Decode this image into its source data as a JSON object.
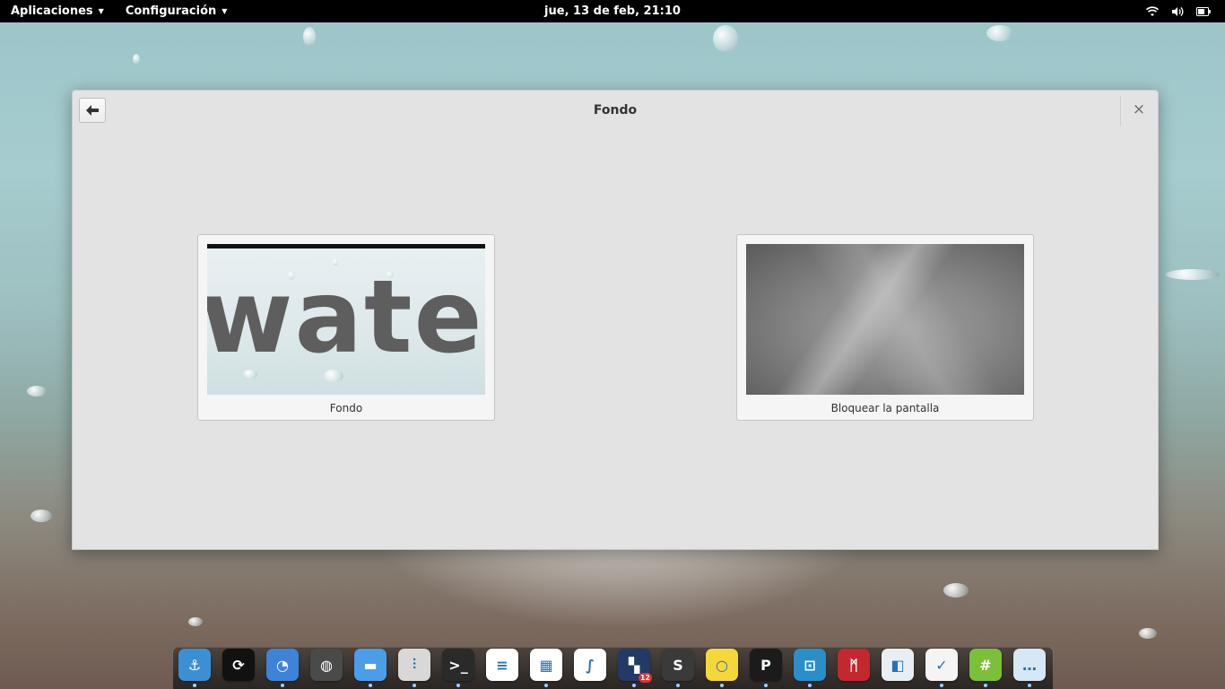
{
  "top_panel": {
    "applications_label": "Aplicaciones",
    "settings_label": "Configuración",
    "clock": "jue, 13 de feb, 21:10",
    "indicators": [
      "wifi-icon",
      "volume-icon",
      "battery-icon"
    ]
  },
  "window": {
    "title": "Fondo",
    "back_icon": "arrow-left-icon",
    "close_label": "×",
    "cards": [
      {
        "label": "Fondo",
        "preview_text": "water"
      },
      {
        "label": "Bloquear la pantalla"
      }
    ]
  },
  "dock": {
    "apps": [
      {
        "name": "anchor-app",
        "color": "#3d8fd4",
        "glyph": "⚓",
        "running": true
      },
      {
        "name": "system-monitor",
        "color": "#111111",
        "glyph": "⟳",
        "running": false
      },
      {
        "name": "firefox",
        "color": "#3f83d8",
        "glyph": "◔",
        "running": true
      },
      {
        "name": "globe-app",
        "color": "#4a4a4a",
        "glyph": "◍",
        "running": false
      },
      {
        "name": "files",
        "color": "#4b9de8",
        "glyph": "▬",
        "running": true
      },
      {
        "name": "settings-app",
        "color": "#d8d8d8",
        "glyph": "⫶",
        "running": true
      },
      {
        "name": "terminal",
        "color": "#2a2a2a",
        "glyph": ">_",
        "running": true
      },
      {
        "name": "writer",
        "color": "#ffffff",
        "glyph": "≡",
        "running": false
      },
      {
        "name": "calc",
        "color": "#ffffff",
        "glyph": "▦",
        "running": true
      },
      {
        "name": "math",
        "color": "#ffffff",
        "glyph": "∫",
        "running": false
      },
      {
        "name": "tasks-badge-app",
        "color": "#233a66",
        "glyph": "▚",
        "badge": "12",
        "running": true
      },
      {
        "name": "sublime",
        "color": "#3a3a3a",
        "glyph": "S",
        "running": true
      },
      {
        "name": "ideas",
        "color": "#f4d83a",
        "glyph": "○",
        "running": true
      },
      {
        "name": "pen-app",
        "color": "#1b1b1b",
        "glyph": "P",
        "running": true
      },
      {
        "name": "remote-app",
        "color": "#2a8ec9",
        "glyph": "⊡",
        "running": true
      },
      {
        "name": "mendeley",
        "color": "#c2282d",
        "glyph": "ᛗ",
        "running": false
      },
      {
        "name": "shapes-app",
        "color": "#e8eef3",
        "glyph": "◧",
        "running": false
      },
      {
        "name": "checklist-app",
        "color": "#f4f4f4",
        "glyph": "✓",
        "running": true
      },
      {
        "name": "hash-app",
        "color": "#7bbf3a",
        "glyph": "#",
        "running": true
      },
      {
        "name": "chat-app",
        "color": "#d6e7f6",
        "glyph": "…",
        "running": true
      }
    ]
  }
}
